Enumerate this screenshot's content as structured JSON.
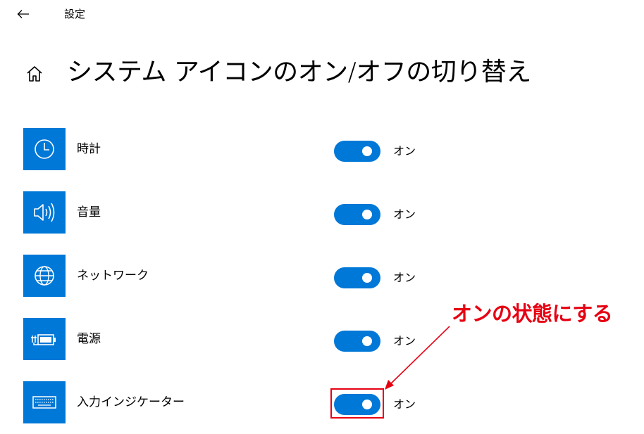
{
  "window": {
    "title": "設定",
    "back_icon": "arrow-left-icon"
  },
  "page": {
    "title": "システム アイコンのオン/オフの切り替え",
    "home_icon": "home-icon"
  },
  "accent_color": "#0078d7",
  "items": [
    {
      "label": "時計",
      "icon": "clock-icon",
      "state": "オン",
      "on": true
    },
    {
      "label": "音量",
      "icon": "volume-icon",
      "state": "オン",
      "on": true
    },
    {
      "label": "ネットワーク",
      "icon": "globe-icon",
      "state": "オン",
      "on": true
    },
    {
      "label": "電源",
      "icon": "battery-plug-icon",
      "state": "オン",
      "on": true
    },
    {
      "label": "入力インジケーター",
      "icon": "keyboard-icon",
      "state": "オン",
      "on": true
    }
  ],
  "annotation": {
    "text": "オンの状態にする",
    "color": "#e60012"
  }
}
